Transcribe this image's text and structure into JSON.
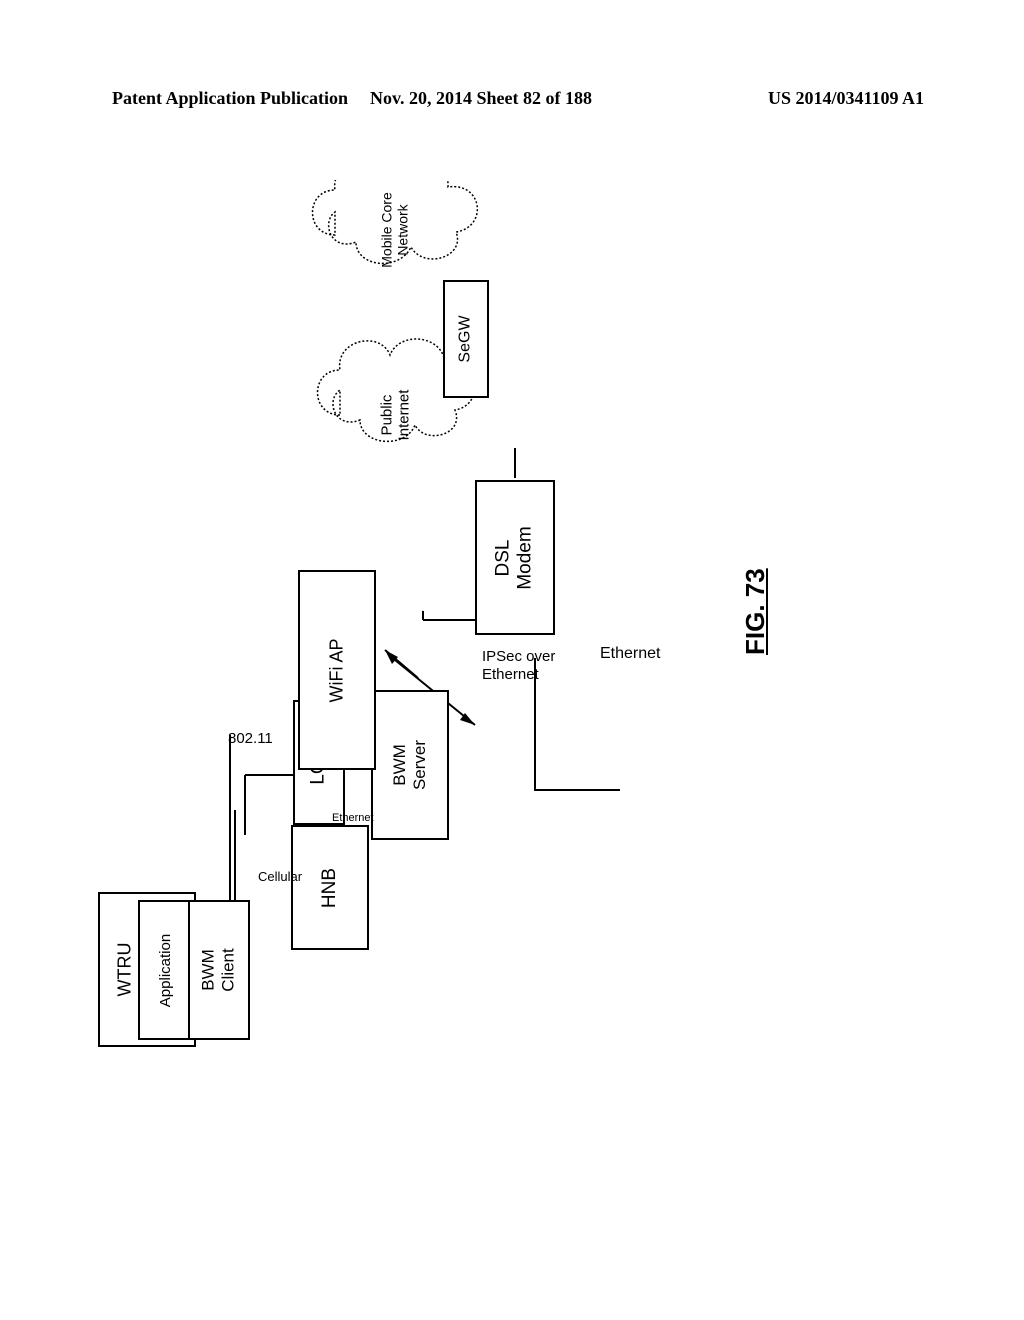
{
  "header": {
    "left": "Patent Application Publication",
    "center": "Nov. 20, 2014  Sheet 82 of 188",
    "right": "US 2014/0341109 A1"
  },
  "figure_label": "FIG. 73",
  "boxes": {
    "wtru": "WTRU",
    "application": "Application",
    "bwm_client": "BWM\nClient",
    "lgw": "LGW",
    "hnb": "HNB",
    "bwm_server": "BWM\nServer",
    "wifi_ap": "WiFi AP",
    "dsl_modem": "DSL\nModem",
    "segw": "SeGW"
  },
  "clouds": {
    "public_internet": "Public\nInternet",
    "mobile_core": "Mobile Core\nNetwork"
  },
  "connections": {
    "cellular": "Cellular",
    "wifi": "802.11",
    "ethernet_small": "Ethernet",
    "ipsec": "IPSec over\nEthernet",
    "ethernet_big": "Ethernet"
  }
}
